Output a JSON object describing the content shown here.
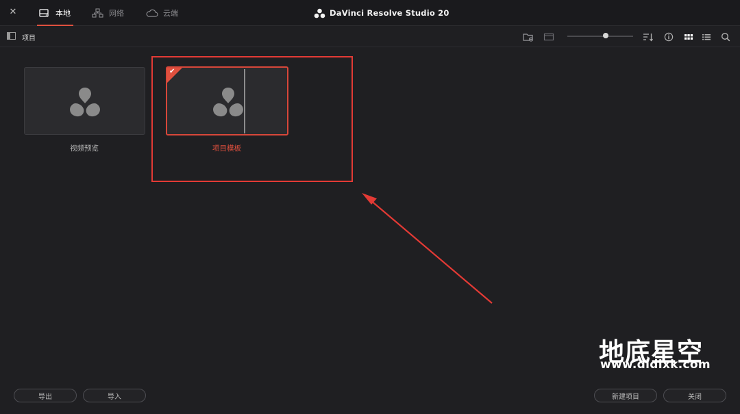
{
  "window": {
    "title": "DaVinci Resolve Studio 20",
    "close_icon": "close-icon"
  },
  "tabs": [
    {
      "label": "本地",
      "icon": "local-drive-icon",
      "active": true
    },
    {
      "label": "网络",
      "icon": "network-icon",
      "active": false
    },
    {
      "label": "云端",
      "icon": "cloud-icon",
      "active": false
    }
  ],
  "toolbar": {
    "breadcrumb": "项目",
    "icons": [
      "sidebar-toggle-icon",
      "new-folder-icon",
      "folder-view-icon",
      "sort-icon",
      "info-icon",
      "grid-view-icon",
      "list-view-icon",
      "search-icon"
    ],
    "thumbnail_size_fraction": 0.55
  },
  "projects": [
    {
      "name": "视频预览",
      "selected": false
    },
    {
      "name": "项目模板",
      "selected": true
    }
  ],
  "footer": {
    "export": "导出",
    "import": "导入",
    "new_project": "新建项目",
    "close": "关闭"
  },
  "watermark": {
    "brand": "地底星空",
    "url": "www.didixk.com"
  },
  "colors": {
    "accent": "#e0503e",
    "annotation": "#e33a35",
    "background": "#1f1f22"
  }
}
